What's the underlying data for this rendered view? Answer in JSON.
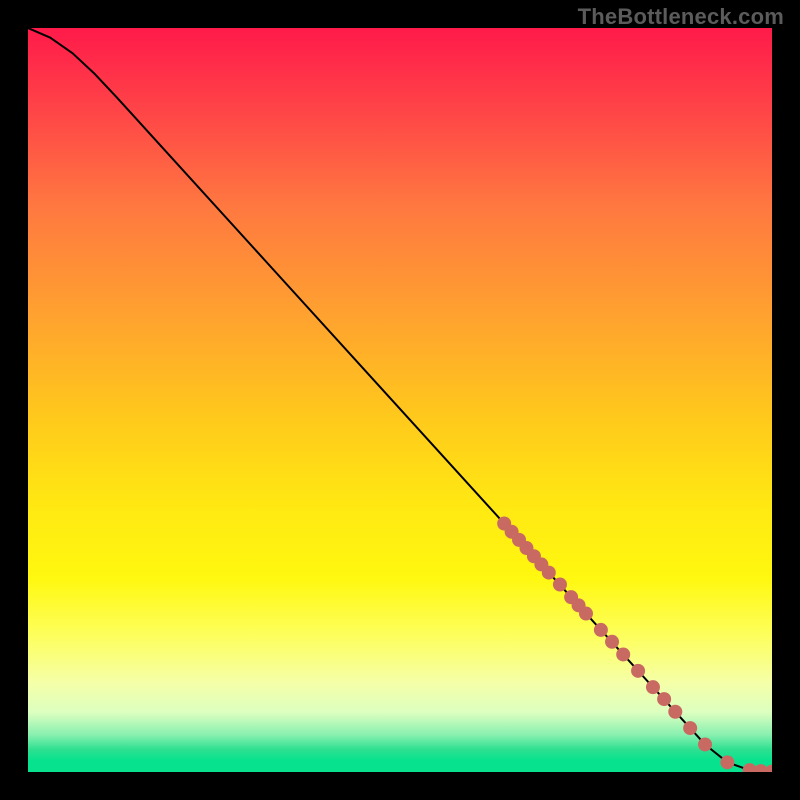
{
  "watermark": "TheBottleneck.com",
  "colors": {
    "curve": "#000000",
    "dot": "#c96a62",
    "gradient_top": "#ff1a4a",
    "gradient_mid": "#ffe812",
    "gradient_bottom": "#06e28e"
  },
  "chart_data": {
    "type": "line",
    "title": "",
    "xlabel": "",
    "ylabel": "",
    "xlim": [
      0,
      100
    ],
    "ylim": [
      0,
      100
    ],
    "series": [
      {
        "name": "curve",
        "x": [
          0,
          3,
          6,
          9,
          12,
          16,
          32,
          48,
          64,
          80,
          84,
          88,
          91,
          94,
          97,
          100
        ],
        "y": [
          100,
          98.7,
          96.6,
          93.8,
          90.6,
          86.2,
          68.6,
          51.0,
          33.4,
          15.8,
          11.4,
          7.0,
          3.7,
          1.3,
          0.25,
          0.05
        ]
      }
    ],
    "markers": [
      {
        "name": "dot-cluster",
        "x": [
          64.0,
          65.0,
          66.0,
          67.0,
          68.0,
          69.0,
          70.0,
          71.5,
          73.0,
          74.0,
          75.0,
          77.0,
          78.5,
          80.0,
          82.0,
          84.0,
          85.5,
          87.0,
          89.0,
          91.0,
          94.0,
          97.0,
          98.5,
          100.0
        ],
        "y": [
          33.4,
          32.3,
          31.2,
          30.1,
          29.0,
          27.9,
          26.8,
          25.2,
          23.5,
          22.4,
          21.3,
          19.1,
          17.5,
          15.8,
          13.6,
          11.4,
          9.8,
          8.1,
          5.9,
          3.7,
          1.3,
          0.25,
          0.12,
          0.05
        ]
      }
    ]
  }
}
